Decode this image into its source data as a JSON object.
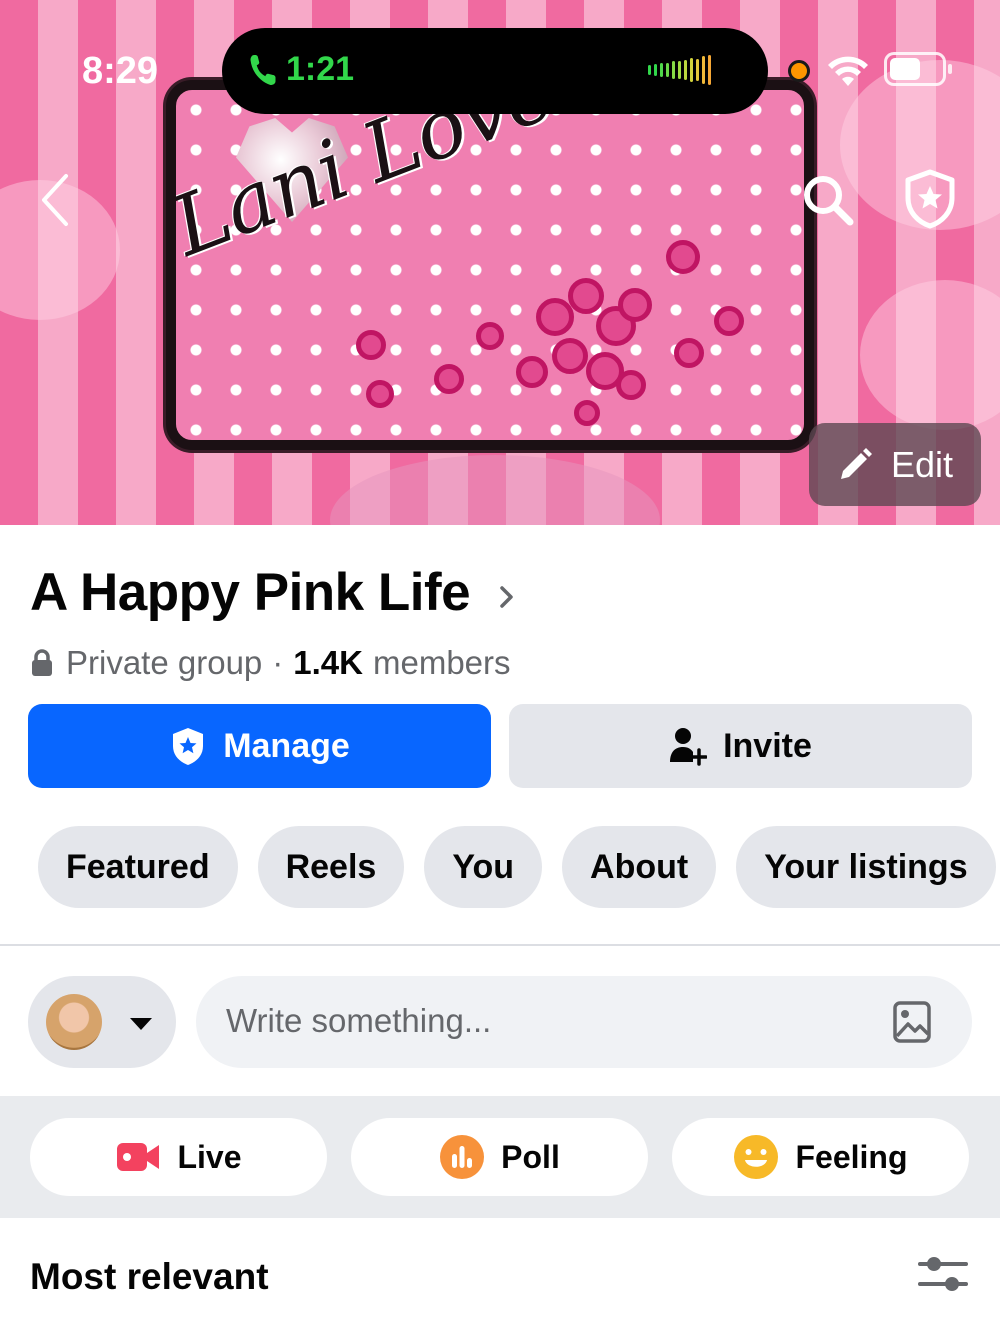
{
  "status_bar": {
    "time": "8:29",
    "call_duration": "1:21",
    "icons": [
      "phone-icon",
      "audio-waveform-icon",
      "orange-mic-dot",
      "wifi-icon",
      "battery-icon"
    ]
  },
  "cover": {
    "artwork_text": "Lani Loves Pink",
    "edit_label": "Edit",
    "icons": [
      "back-chevron-icon",
      "search-icon",
      "admin-shield-icon",
      "pencil-icon"
    ]
  },
  "group": {
    "name": "A Happy Pink Life",
    "privacy": "Private group",
    "separator": "·",
    "member_count": "1.4K",
    "member_label": "members"
  },
  "actions": {
    "manage_label": "Manage",
    "invite_label": "Invite"
  },
  "tabs": [
    {
      "label": "Featured"
    },
    {
      "label": "Reels"
    },
    {
      "label": "You"
    },
    {
      "label": "About"
    },
    {
      "label": "Your listings"
    }
  ],
  "composer": {
    "placeholder": "Write something..."
  },
  "post_types": [
    {
      "label": "Live",
      "icon": "live-video-icon",
      "color": "#f3425f"
    },
    {
      "label": "Poll",
      "icon": "poll-icon",
      "color": "#f7923b"
    },
    {
      "label": "Feeling",
      "icon": "feeling-smiley-icon",
      "color": "#f7b928"
    }
  ],
  "feed": {
    "sort_label": "Most relevant"
  },
  "colors": {
    "primary_blue": "#0866ff",
    "button_gray": "#e4e6eb",
    "secondary_text": "#65676b",
    "call_green": "#32d74b"
  }
}
